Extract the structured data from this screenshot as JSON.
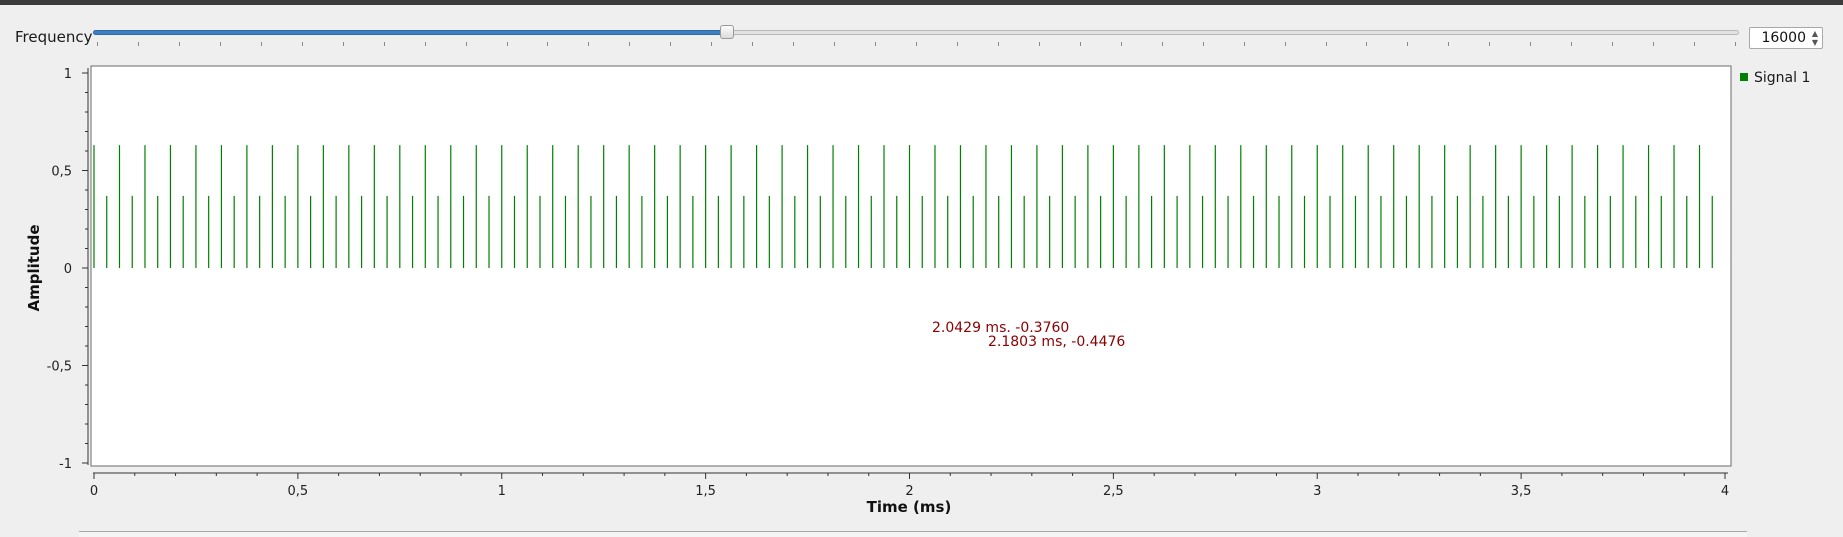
{
  "controls": {
    "frequency_label": "Frequency",
    "frequency_value": "16000",
    "slider_fraction": 0.385
  },
  "legend": {
    "label": "Signal 1",
    "color": "#008000"
  },
  "annotations": [
    {
      "text": "2.0429 ms. -0.3760",
      "color": "#8b0000"
    },
    {
      "text": "2.1803 ms, -0.4476",
      "color": "#8b0000"
    }
  ],
  "chart_data": {
    "type": "line",
    "xlabel": "Time (ms)",
    "ylabel": "Amplitude",
    "xlim": [
      0,
      4
    ],
    "ylim": [
      -1,
      1
    ],
    "xticks": [
      0,
      0.5,
      1,
      1.5,
      2,
      2.5,
      3,
      3.5,
      4
    ],
    "xtick_labels": [
      "0",
      "0,5",
      "1",
      "1,5",
      "2",
      "2,5",
      "3",
      "3,5",
      "4"
    ],
    "yticks": [
      1,
      0.5,
      0,
      -0.5,
      -1
    ],
    "ytick_labels": [
      "1",
      "0,5",
      "0",
      "-0,5",
      "-1"
    ],
    "grid": false,
    "legend_position": "right",
    "series": [
      {
        "name": "Signal 1",
        "color": "#008000",
        "style": "impulses",
        "sample_period_ms": 0.03125,
        "first_sample_ms": 0,
        "last_sample_ms": 3.96875,
        "values_alternating": [
          0.63,
          0.37
        ]
      }
    ]
  }
}
